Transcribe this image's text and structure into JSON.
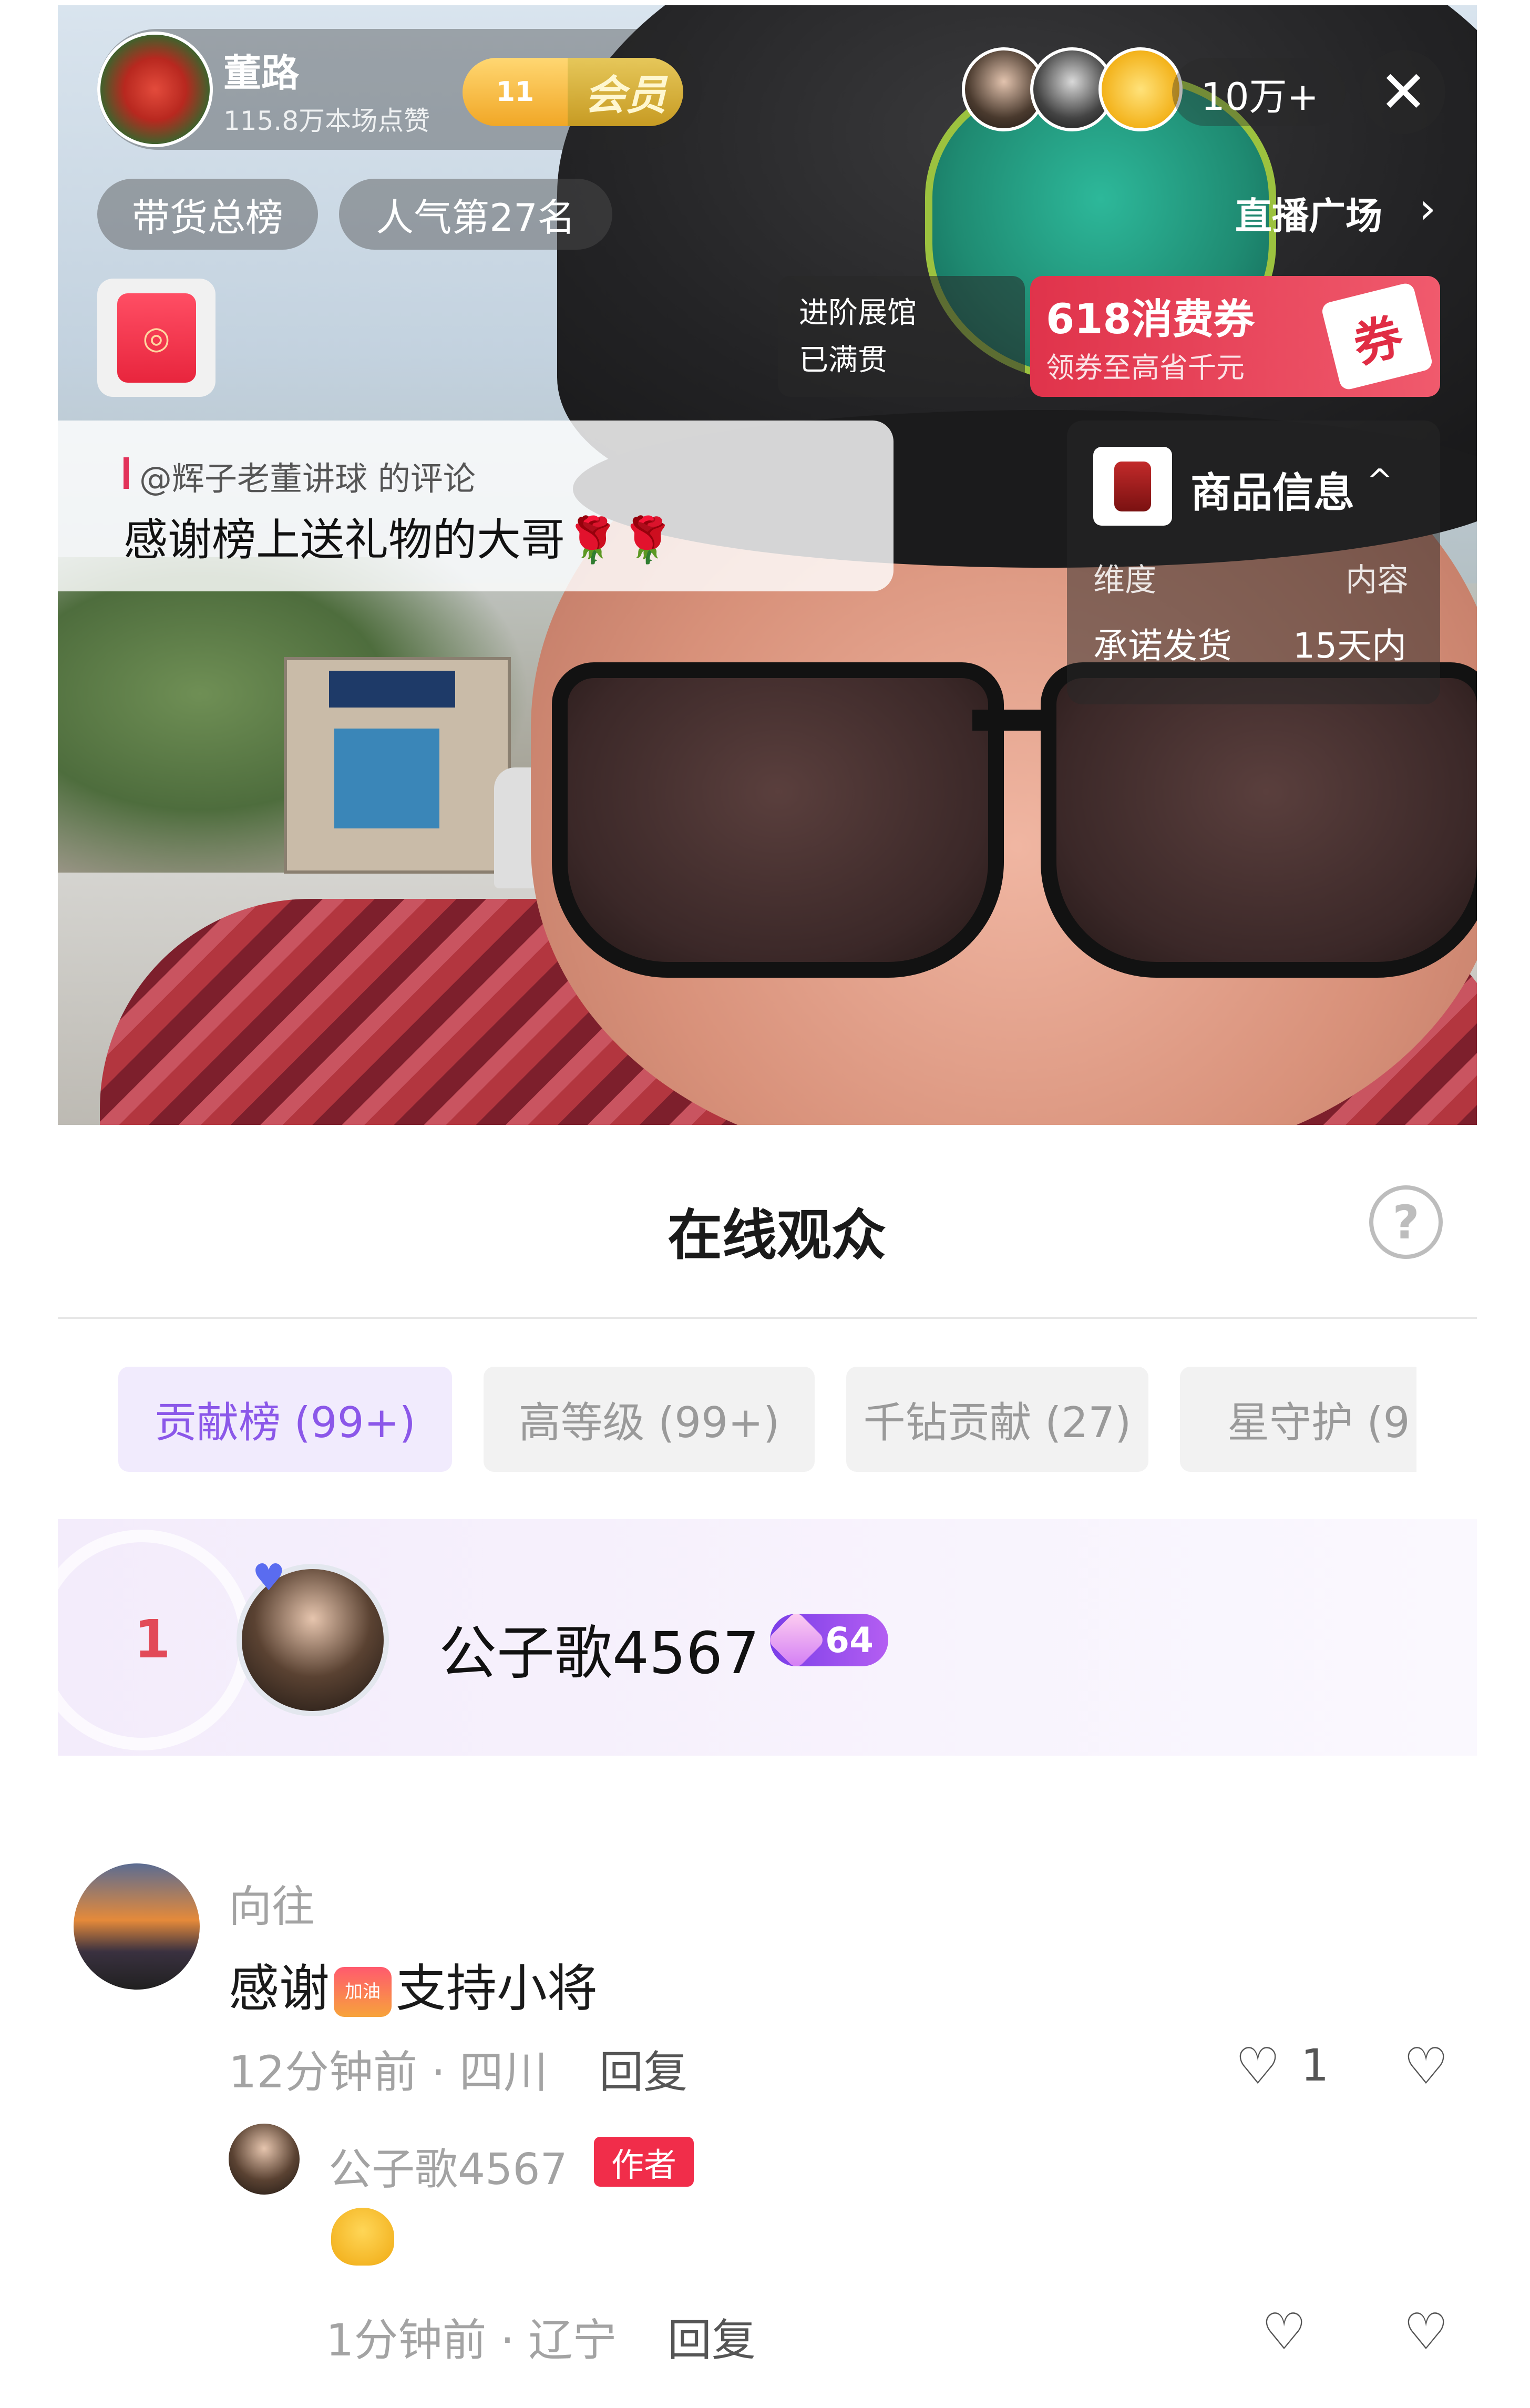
{
  "host": {
    "name": "董路",
    "likes": "115.8万本场点赞",
    "fan_level": "11",
    "vip_label": "会员"
  },
  "viewers": {
    "count": "10万+"
  },
  "close_glyph": "✕",
  "chips": {
    "sales_rank": "带货总榜",
    "popularity_rank": "人气第27名"
  },
  "live_plaza": {
    "label": "直播广场",
    "chevron": "›"
  },
  "promo": {
    "line1": "进阶展馆",
    "line2": "已满贯"
  },
  "coupon": {
    "title": "618消费券",
    "subtitle": "领券至高省千元",
    "tag": "券"
  },
  "pinned_comment": {
    "header": "@辉子老董讲球 的评论",
    "text": "感谢榜上送礼物的大哥🌹🌹"
  },
  "product_info": {
    "title": "商品信息",
    "chevron": "^",
    "col1_header": "维度",
    "col2_header": "内容",
    "row_label": "承诺发货",
    "row_value": "15天内"
  },
  "audience_sheet": {
    "title": "在线观众",
    "help": "?",
    "tabs": [
      {
        "label": "贡献榜 (99+)"
      },
      {
        "label": "高等级 (99+)"
      },
      {
        "label": "千钻贡献 (27)"
      },
      {
        "label": "星守护 (9"
      }
    ],
    "top_rank": {
      "rank": "1",
      "username": "公子歌4567",
      "level": "64"
    }
  },
  "comments": [
    {
      "username": "向往",
      "text_before": "感谢",
      "emoji_label": "加油",
      "text_after": "支持小将",
      "time_location": "12分钟前 · 四川",
      "reply_label": "回复",
      "like_count": "1",
      "reply": {
        "username": "公子歌4567",
        "author_tag": "作者",
        "time_location": "1分钟前 · 辽宁",
        "reply_label": "回复"
      }
    }
  ],
  "colors": {
    "accent_purple": "#8b57e9",
    "rank_red": "#e24a58",
    "author_tag_red": "#f12d4a",
    "coupon_red": "#e0334b"
  }
}
